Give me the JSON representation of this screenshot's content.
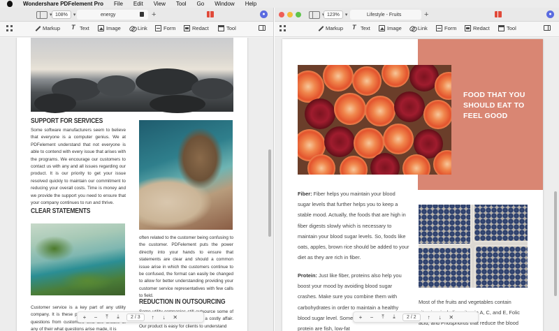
{
  "menubar": {
    "app_name": "Wondershare PDFelement Pro",
    "items": [
      "File",
      "Edit",
      "View",
      "Tool",
      "Go",
      "Window",
      "Help"
    ]
  },
  "left_window": {
    "zoom": "108%",
    "tab_title": "energy",
    "toolbar": [
      "Markup",
      "Text",
      "Image",
      "Link",
      "Form",
      "Redact",
      "Tool"
    ],
    "page": {
      "heading1": "SUPPORT FOR SERVICES",
      "para1": "Some software manufacturers seem to believe that everyone is a computer genius. We at PDFelement understand that not everyone is able to contend with every issue that arises with the programs. We encourage our customers to contact us with any and all issues regarding our product. It is our priority to get your issue resolved quickly to maintain our commitment to reducing your overall costs. Time is money and we provide the support you need to ensure that your company continues to run and thrive.",
      "heading2": "CLEAR STATEMENTS",
      "para2": "often related to the customer being confusing to the customer. PDFelement puts the power directly into your hands to ensure that statements are clear and should a common issue arise in which the customers continue to be confused, the format can easily be changed to allow for better understanding providing your customer service representatives with few calls to field.",
      "heading3": "REDUCTION IN OUTSOURCING",
      "para3": "Customer service is a key part of any utility company. It is these people that have to field questions from customers who are unsure of any of their what questions arise made, it is",
      "para4": "Some utility companies still outsource some of their services. Doing so can be a costly affair. Our product is easy for clients to understand"
    },
    "pager": {
      "current": "2",
      "sep": "/",
      "total": "3"
    }
  },
  "right_window": {
    "zoom": "123%",
    "tab_title": "Lifestyle - Fruits",
    "toolbar": [
      "Markup",
      "Text",
      "Image",
      "Link",
      "Form",
      "Redact",
      "Tool"
    ],
    "page": {
      "title": "FOOD THAT YOU SHOULD EAT TO FEEL GOOD",
      "fiber_label": "Fiber:",
      "fiber_text": "Fiber helps you maintain your blood sugar levels that further helps you to keep a stable mood. Actually, the foods that are high in fiber digests slowly which is necessary to maintain your blood sugar levels. So, foods like oats, apples, brown rice should be added to your diet as they are rich in fiber.",
      "protein_label": "Protein:",
      "protein_text": "Just like fiber, proteins also help you boost your mood by avoiding blood sugar crashes. Make sure you combine them with carbohydrates in order to maintain a healthy blood sugar level. Some of the good sources of protein are fish, low-fat",
      "side_text": "Most of the fruits and vegetables contain vitamins, including vitamin A, C, and E, Folic acid, and Phosphorus that reduce the blood"
    },
    "pager": {
      "current": "2",
      "sep": "/",
      "total": "2"
    }
  }
}
